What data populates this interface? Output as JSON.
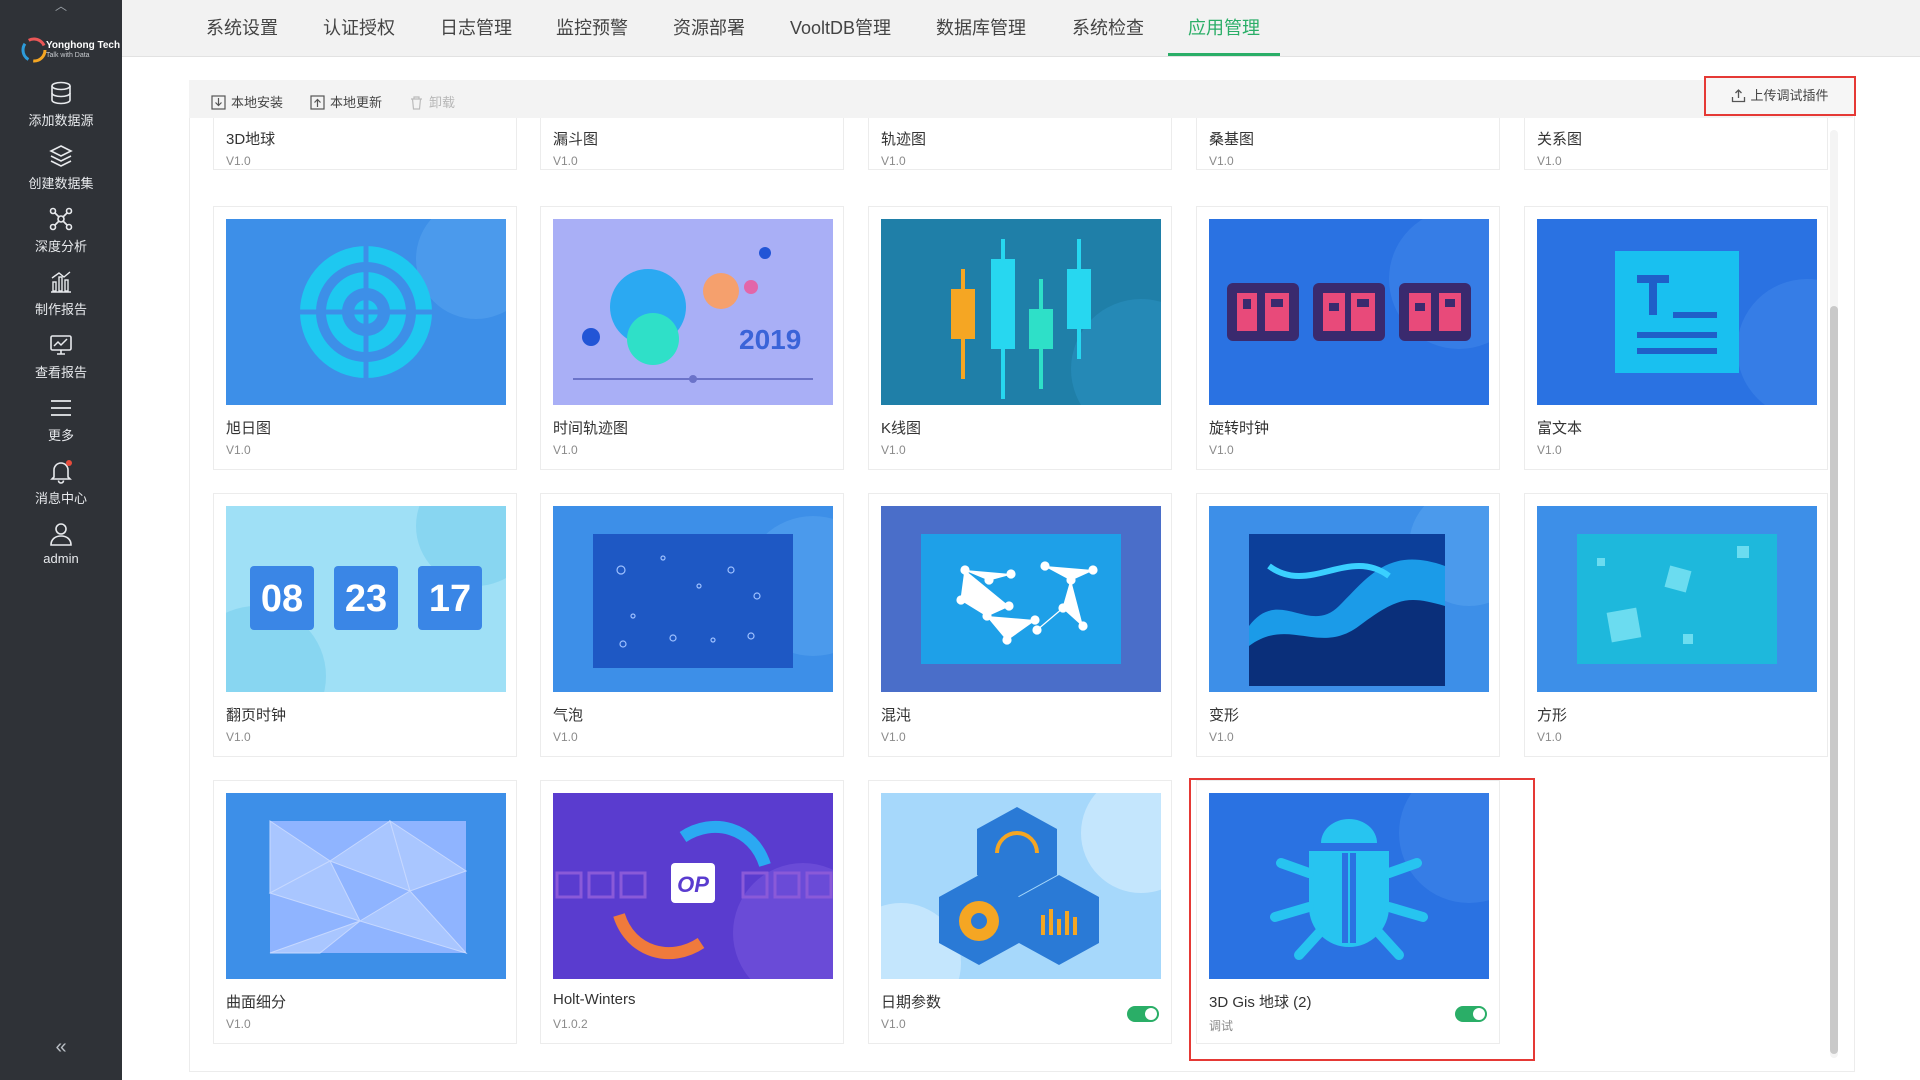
{
  "logo": {
    "line1": "Yonghong Tech",
    "line2": "Talk with Data"
  },
  "sidebar": {
    "items": [
      {
        "label": "添加数据源",
        "icon": "database-icon"
      },
      {
        "label": "创建数据集",
        "icon": "layers-icon"
      },
      {
        "label": "深度分析",
        "icon": "network-analysis-icon"
      },
      {
        "label": "制作报告",
        "icon": "bar-chart-icon"
      },
      {
        "label": "查看报告",
        "icon": "monitor-chart-icon"
      },
      {
        "label": "更多",
        "icon": "menu-icon"
      },
      {
        "label": "消息中心",
        "icon": "bell-icon"
      },
      {
        "label": "admin",
        "icon": "user-icon"
      }
    ],
    "collapse_glyph": "«"
  },
  "tabs": [
    {
      "label": "系统设置",
      "active": false
    },
    {
      "label": "认证授权",
      "active": false
    },
    {
      "label": "日志管理",
      "active": false
    },
    {
      "label": "监控预警",
      "active": false
    },
    {
      "label": "资源部署",
      "active": false
    },
    {
      "label": "VooltDB管理",
      "active": false
    },
    {
      "label": "数据库管理",
      "active": false
    },
    {
      "label": "系统检查",
      "active": false
    },
    {
      "label": "应用管理",
      "active": true
    }
  ],
  "toolbar": {
    "local_install": "本地安装",
    "local_update": "本地更新",
    "uninstall": "卸载",
    "upload_debug": "上传调试插件"
  },
  "plugins_top": [
    {
      "name": "3D地球",
      "version": "V1.0"
    },
    {
      "name": "漏斗图",
      "version": "V1.0"
    },
    {
      "name": "轨迹图",
      "version": "V1.0"
    },
    {
      "name": "桑基图",
      "version": "V1.0"
    },
    {
      "name": "关系图",
      "version": "V1.0"
    }
  ],
  "plugins": [
    {
      "name": "旭日图",
      "version": "V1.0",
      "thumb": "sunburst"
    },
    {
      "name": "时间轨迹图",
      "version": "V1.0",
      "thumb": "timeline",
      "thumb_text": "2019"
    },
    {
      "name": "K线图",
      "version": "V1.0",
      "thumb": "kline"
    },
    {
      "name": "旋转时钟",
      "version": "V1.0",
      "thumb": "rotclock"
    },
    {
      "name": "富文本",
      "version": "V1.0",
      "thumb": "richtext"
    },
    {
      "name": "翻页时钟",
      "version": "V1.0",
      "thumb": "flipclock",
      "digits": [
        "08",
        "23",
        "17"
      ]
    },
    {
      "name": "气泡",
      "version": "V1.0",
      "thumb": "bubble"
    },
    {
      "name": "混沌",
      "version": "V1.0",
      "thumb": "chaos"
    },
    {
      "name": "变形",
      "version": "V1.0",
      "thumb": "deform"
    },
    {
      "name": "方形",
      "version": "V1.0",
      "thumb": "square"
    },
    {
      "name": "曲面细分",
      "version": "V1.0",
      "thumb": "tessellation"
    },
    {
      "name": "Holt-Winters",
      "version": "V1.0.2",
      "thumb": "holtwinters",
      "thumb_text": "OP"
    },
    {
      "name": "日期参数",
      "version": "V1.0",
      "thumb": "dateparam",
      "enabled": true
    },
    {
      "name": "3D Gis 地球 (2)",
      "version": "调试",
      "thumb": "debug",
      "enabled": true
    }
  ],
  "colors": {
    "accent": "#2aae67",
    "highlight": "#e53935",
    "sidebar": "#2f3237"
  }
}
